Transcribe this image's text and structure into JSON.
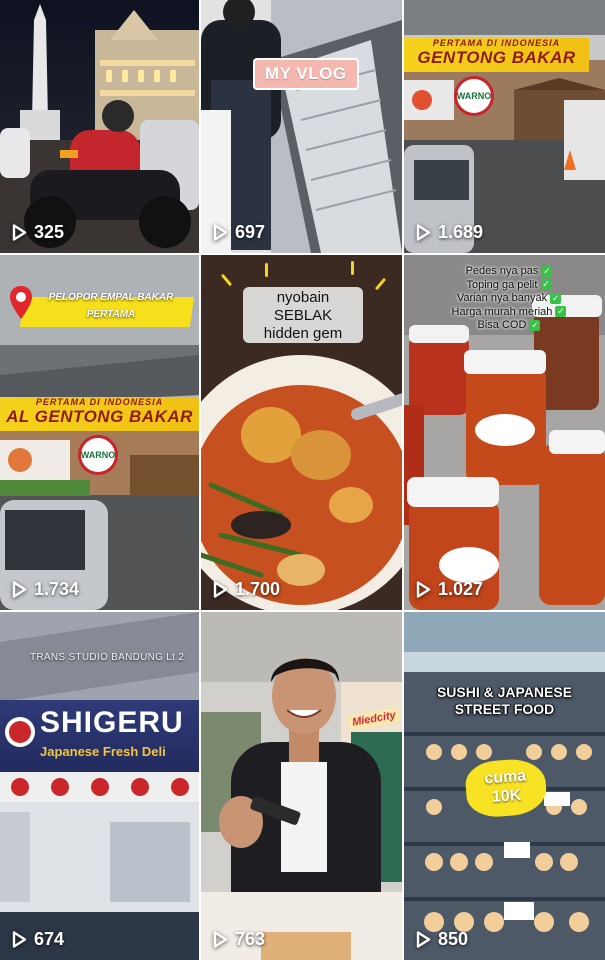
{
  "feed": {
    "items": [
      {
        "views": "325"
      },
      {
        "views": "697",
        "overlay": "MY VLOG"
      },
      {
        "views": "1.689",
        "sign_small": "PERTAMA DI INDONESIA",
        "sign_big": "GENTONG BAKAR",
        "logo": "WARNO"
      },
      {
        "views": "1.734",
        "tag": "PELOPOR EMPAL BAKAR PERTAMA",
        "sign_small": "PERTAMA DI INDONESIA",
        "sign_big": "AL GENTONG BAKAR",
        "logo": "WARNO"
      },
      {
        "views": "1.700",
        "caption_lines": [
          "nyobain",
          "SEBLAK",
          "hidden gem"
        ]
      },
      {
        "views": "1.027",
        "checklist": [
          "Pedes nya pas",
          "Toping ga pelit",
          "Varian nya banyak",
          "Harga murah meriah",
          "Bisa COD"
        ]
      },
      {
        "views": "674",
        "location": "TRANS STUDIO BANDUNG Lt 2",
        "store_name": "SHIGERU",
        "store_sub": "Japanese Fresh Deli"
      },
      {
        "views": "763",
        "sign": "Miedcity"
      },
      {
        "views": "850",
        "title_lines": [
          "SUSHI & JAPANESE",
          "STREET FOOD"
        ],
        "badge_lines": [
          "cuma",
          "10K"
        ]
      }
    ]
  },
  "icons": {
    "play": "play-icon",
    "location": "location-pin-icon",
    "check": "check-icon"
  },
  "colors": {
    "views_text": "#ffffff",
    "check": "#3ac149",
    "banner": "#f4d21c",
    "pill": "#f5b8b0"
  }
}
